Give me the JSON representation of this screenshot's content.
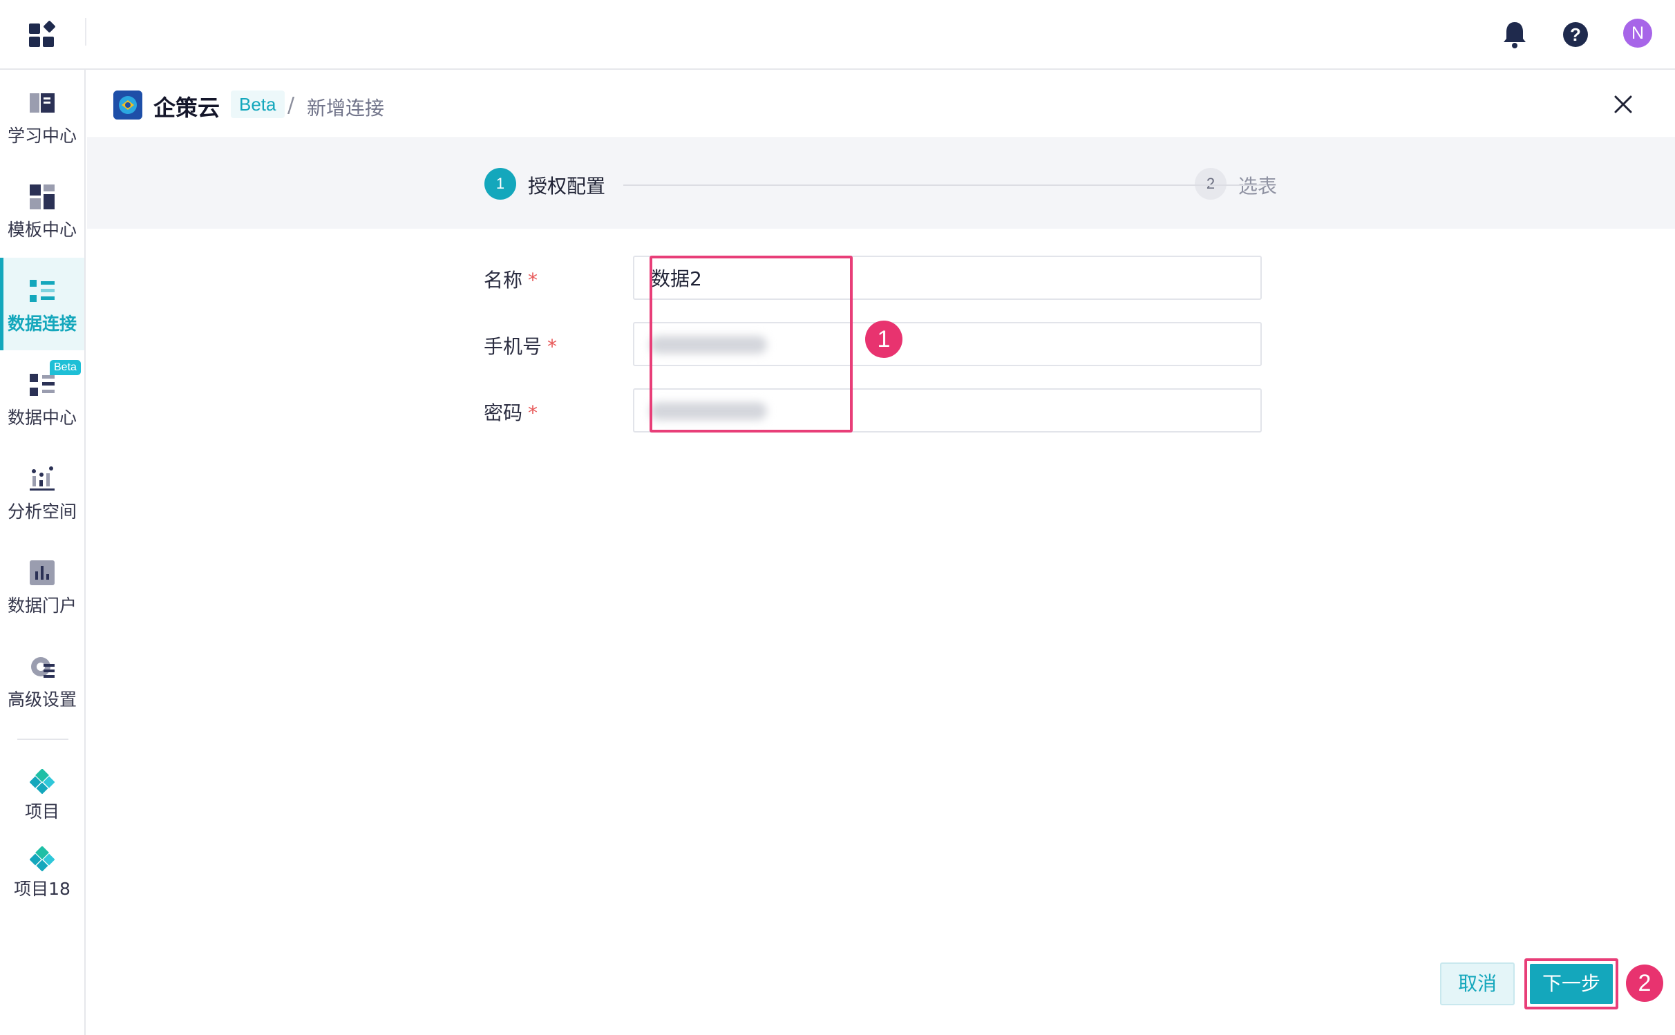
{
  "topbar": {
    "icons": [
      "app-grid-icon",
      "bell-icon",
      "help-icon"
    ],
    "avatar_initial": "N"
  },
  "sidebar": {
    "items": [
      {
        "label": "学习中心",
        "icon": "book-icon"
      },
      {
        "label": "模板中心",
        "icon": "template-icon"
      },
      {
        "label": "数据连接",
        "icon": "data-connect-icon",
        "active": true
      },
      {
        "label": "数据中心",
        "icon": "data-center-icon",
        "badge": "Beta"
      },
      {
        "label": "分析空间",
        "icon": "analysis-icon"
      },
      {
        "label": "数据门户",
        "icon": "portal-icon"
      },
      {
        "label": "高级设置",
        "icon": "settings-gear-icon"
      }
    ],
    "projects": [
      {
        "label": "项目",
        "icon": "project-diamond-icon"
      },
      {
        "label": "项目18",
        "icon": "project-diamond-icon"
      }
    ]
  },
  "header": {
    "brand": "企策云",
    "beta": "Beta",
    "separator": "/",
    "current": "新增连接"
  },
  "steps": [
    {
      "number": "1",
      "label": "授权配置",
      "state": "active"
    },
    {
      "number": "2",
      "label": "选表",
      "state": "pending"
    }
  ],
  "form": {
    "fields": [
      {
        "label": "名称",
        "required": "*",
        "value": "数据2"
      },
      {
        "label": "手机号",
        "required": "*",
        "value": ""
      },
      {
        "label": "密码",
        "required": "*",
        "value": ""
      }
    ]
  },
  "annotations": {
    "marker1": "1",
    "marker2": "2"
  },
  "footer": {
    "cancel": "取消",
    "next": "下一步"
  },
  "colors": {
    "accent": "#14a7bc",
    "highlight": "#e83e78",
    "required": "#e85858"
  }
}
